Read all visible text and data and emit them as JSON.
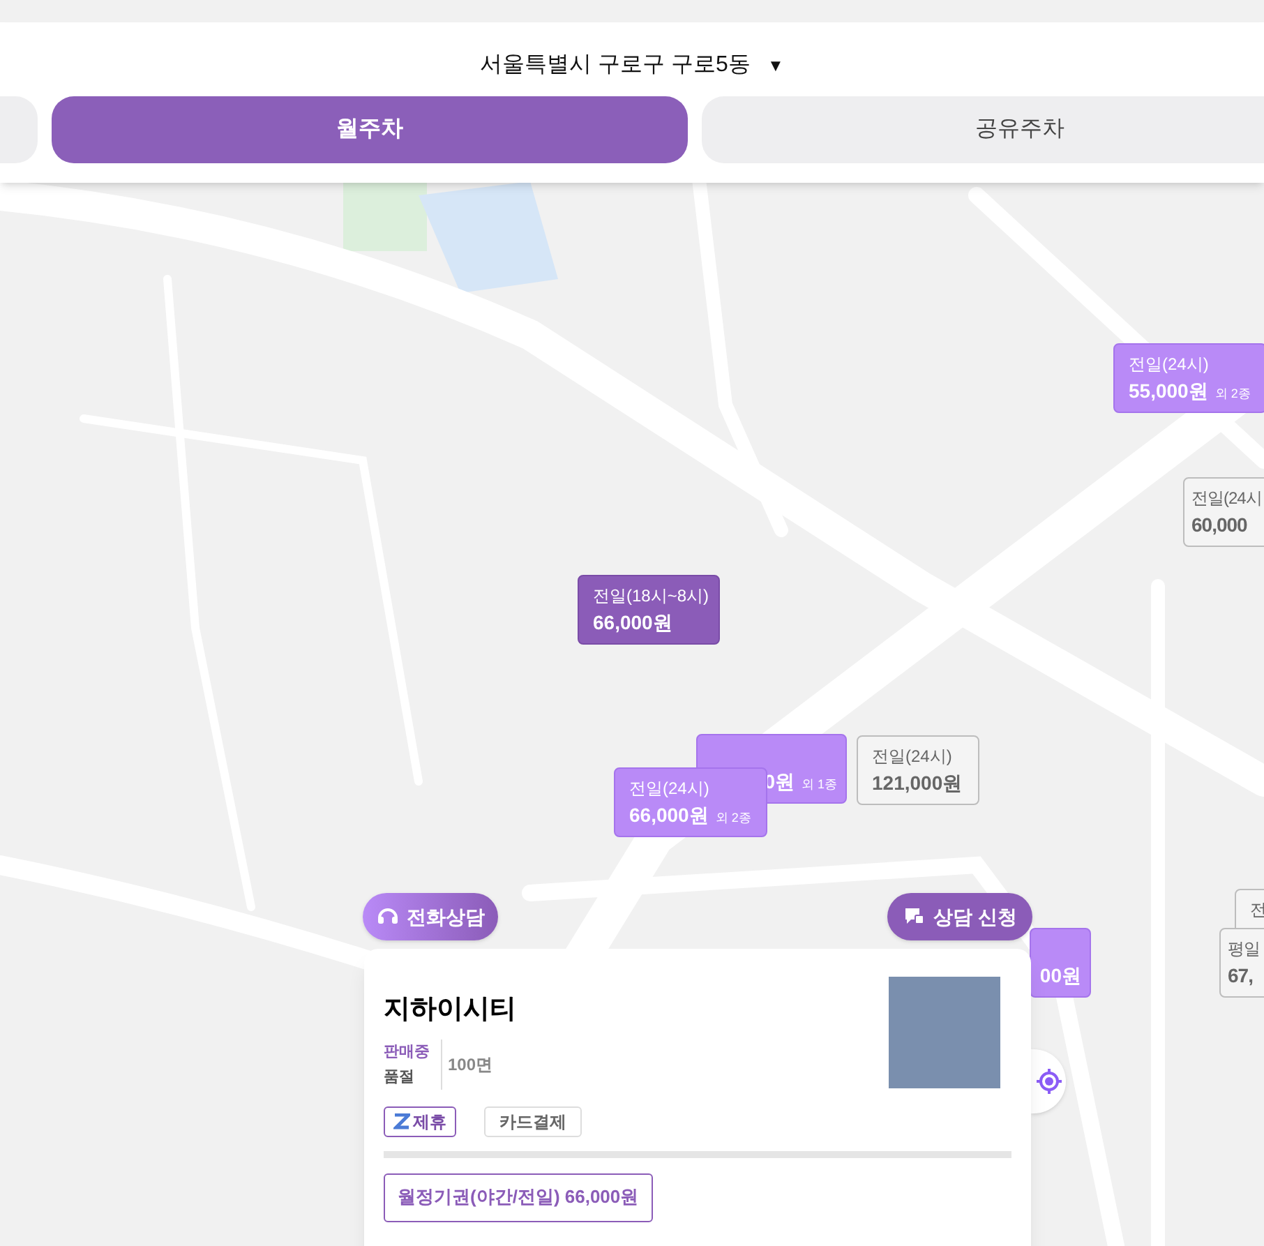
{
  "location": {
    "text": "서울특별시 구로구 구로5동",
    "caret": "▼"
  },
  "tabs": [
    {
      "label": "월주차",
      "selected": true
    },
    {
      "label": "공유주차",
      "selected": false
    }
  ],
  "markers": [
    {
      "kind": "selected",
      "title": "전일(18시~8시)",
      "price": "66,000원"
    },
    {
      "kind": "available",
      "title": "전일(24시)",
      "price": "55,000원",
      "extra": "외 2종"
    },
    {
      "kind": "soldout",
      "title": "전일(24시",
      "price": "60,000"
    },
    {
      "kind": "available",
      "price": "0원",
      "extra": "외 1종"
    },
    {
      "kind": "soldout",
      "title": "전일(24시)",
      "price": "121,000원"
    },
    {
      "kind": "available",
      "title": "전일(24시)",
      "price": "66,000원",
      "extra": "외 2종"
    },
    {
      "kind": "available",
      "price": "00원"
    },
    {
      "kind": "soldout",
      "title": "전"
    },
    {
      "kind": "soldout",
      "title": "평일",
      "price": "67,"
    }
  ],
  "actions": [
    {
      "label": "전화상담",
      "kind": "phone"
    },
    {
      "label": "상담 신청",
      "kind": "apply"
    }
  ],
  "card": {
    "name": "지하이시티",
    "status_on": "판매중",
    "status_off": "품절",
    "spaces": "100면",
    "tags": [
      {
        "label": "제휴",
        "kind": "partner"
      },
      {
        "label": "카드결제",
        "kind": "plain"
      }
    ],
    "products": [
      "월정기권(야간/전일) 66,000원"
    ]
  }
}
